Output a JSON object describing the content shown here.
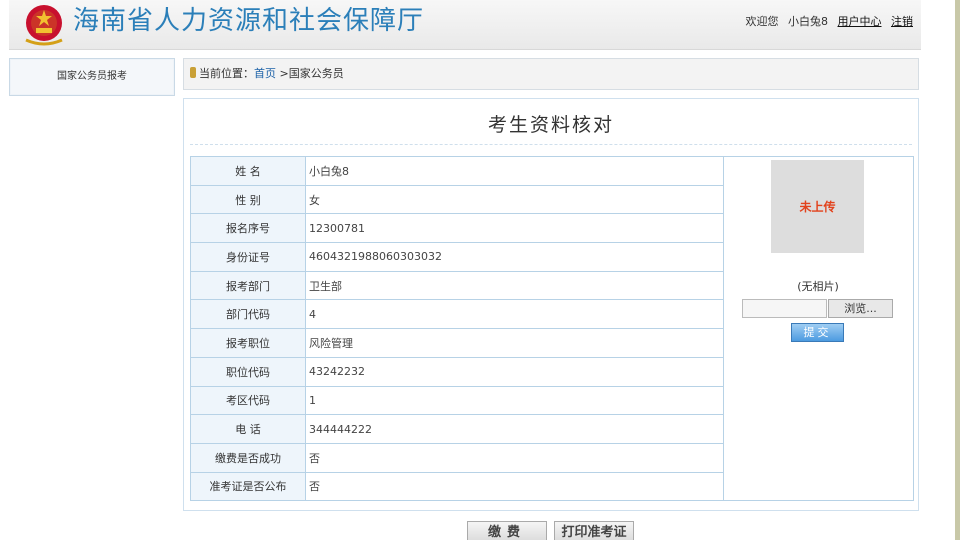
{
  "header": {
    "title": "海南省人力资源和社会保障厅",
    "welcome": "欢迎您",
    "username": "小白兔8",
    "user_center": "用户中心",
    "logout": "注销"
  },
  "sidebar": {
    "items": [
      {
        "label": "国家公务员报考"
      }
    ]
  },
  "breadcrumb": {
    "prefix": "当前位置：",
    "home": "首页",
    "sep": " >",
    "current": "国家公务员"
  },
  "panel": {
    "title": "考生资料核对"
  },
  "table": {
    "rows": [
      {
        "label": "姓  名",
        "value": "小白兔8"
      },
      {
        "label": "性  别",
        "value": "女"
      },
      {
        "label": "报名序号",
        "value": "12300781"
      },
      {
        "label": "身份证号",
        "value": "4604321988060303032"
      },
      {
        "label": "报考部门",
        "value": "卫生部"
      },
      {
        "label": "部门代码",
        "value": "4"
      },
      {
        "label": "报考职位",
        "value": "风险管理"
      },
      {
        "label": "职位代码",
        "value": "43242232"
      },
      {
        "label": "考区代码",
        "value": "1"
      },
      {
        "label": "电  话",
        "value": "344444222"
      },
      {
        "label": "缴费是否成功",
        "value": "否"
      },
      {
        "label": "准考证是否公布",
        "value": "否"
      }
    ]
  },
  "photo": {
    "placeholder": "未上传",
    "caption": "(无相片)",
    "browse_label": "浏览...",
    "submit_label": "提交"
  },
  "actions": {
    "pay_label": "缴费",
    "print_label": "打印准考证"
  },
  "colors": {
    "title_blue": "#2b7fb9",
    "link_blue": "#1d62a8",
    "table_border": "#b7d2e6",
    "photo_text": "#e2421c"
  }
}
